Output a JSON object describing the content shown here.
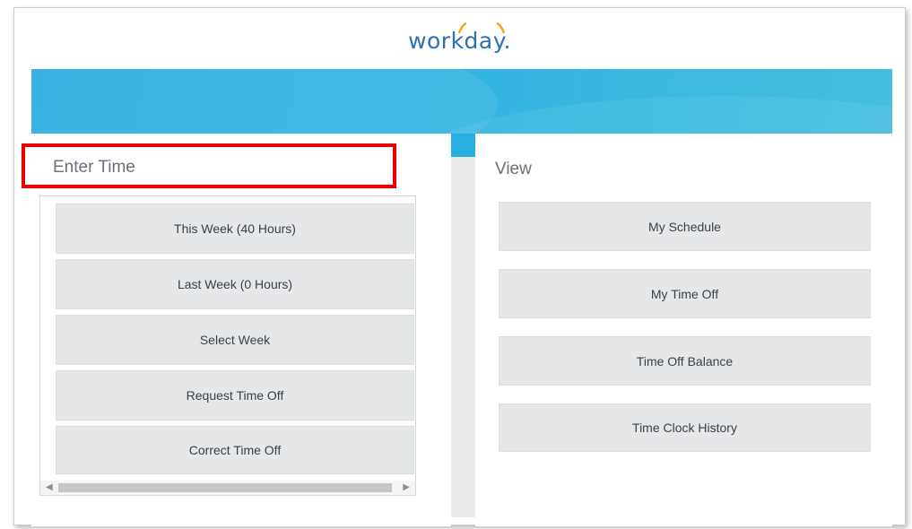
{
  "logo": {
    "text": "workday."
  },
  "enter_time": {
    "title": "Enter Time",
    "buttons": [
      "This Week (40 Hours)",
      "Last Week (0 Hours)",
      "Select Week",
      "Request Time Off",
      "Correct Time Off"
    ]
  },
  "view": {
    "title": "View",
    "buttons": [
      "My Schedule",
      "My Time Off",
      "Time Off Balance",
      "Time Clock History"
    ]
  },
  "colors": {
    "banner": "#29aee0",
    "highlight": "#ee0000",
    "logo_text": "#2e6fad",
    "logo_accent": "#f5a623"
  },
  "icons": {
    "scroll_left": "triangle-left",
    "scroll_right": "triangle-right"
  }
}
